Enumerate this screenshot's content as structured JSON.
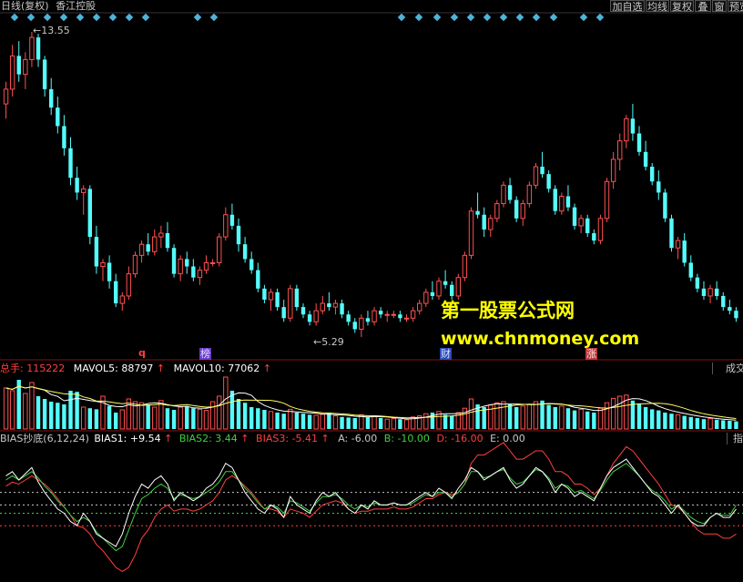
{
  "window": {
    "title_period": "日线(复权)",
    "stock_name": "香江控股",
    "right_buttons": [
      "加自选",
      "均线",
      "复权",
      "叠",
      "窗",
      "预览"
    ]
  },
  "price_chart": {
    "high_label": "13.55",
    "low_label": "5.29",
    "event_tags": [
      "q",
      "榜",
      "财",
      "涨"
    ]
  },
  "volume_panel": {
    "total_label": "总手",
    "total_value": "115222",
    "mavol5_label": "MAVOL5",
    "mavol5_value": "88797",
    "mavol10_label": "MAVOL10",
    "mavol10_value": "77062",
    "right_tab": "成交"
  },
  "bias_panel": {
    "name": "BIAS抄底(6,12,24)",
    "bias1": "BIAS1: +9.54",
    "bias2": "BIAS2: 3.44",
    "bias3": "BIAS3: -5.41",
    "a": "A: -6.00",
    "b": "B: -10.00",
    "d": "D: -16.00",
    "e": "E: 0.00",
    "right_tab": "指"
  },
  "watermark": {
    "line1": "第一股票公式网",
    "line2": "www.chnmoney.com"
  },
  "colors": {
    "up": "#ff5050",
    "down": "#54fcfc",
    "bias1": "#ffffff",
    "bias2": "#40d040",
    "bias3": "#ff4040",
    "watermark": "#ffff00"
  },
  "chart_data": {
    "type": "candlestick",
    "price_max": 13.55,
    "price_min": 5.29,
    "ohlc": [
      [
        11.6,
        12.2,
        11.2,
        12.0
      ],
      [
        12.0,
        13.2,
        11.8,
        12.9
      ],
      [
        12.9,
        13.3,
        12.2,
        12.4
      ],
      [
        12.4,
        13.0,
        12.0,
        12.8
      ],
      [
        12.8,
        13.55,
        12.6,
        13.4
      ],
      [
        13.4,
        13.5,
        12.6,
        12.8
      ],
      [
        12.8,
        12.9,
        11.8,
        12.0
      ],
      [
        12.0,
        12.3,
        11.3,
        11.5
      ],
      [
        11.5,
        11.8,
        10.8,
        11.0
      ],
      [
        11.0,
        11.3,
        10.2,
        10.4
      ],
      [
        10.4,
        10.7,
        9.4,
        9.6
      ],
      [
        9.6,
        9.9,
        9.0,
        9.2
      ],
      [
        9.2,
        9.4,
        8.6,
        9.3
      ],
      [
        9.3,
        9.4,
        7.8,
        8.0
      ],
      [
        8.0,
        8.3,
        7.0,
        7.2
      ],
      [
        7.2,
        7.4,
        6.8,
        7.3
      ],
      [
        7.3,
        7.5,
        6.6,
        6.8
      ],
      [
        6.8,
        7.0,
        6.1,
        6.2
      ],
      [
        6.2,
        6.5,
        6.0,
        6.4
      ],
      [
        6.4,
        7.2,
        6.3,
        7.0
      ],
      [
        7.0,
        7.6,
        6.9,
        7.5
      ],
      [
        7.5,
        7.9,
        7.3,
        7.8
      ],
      [
        7.8,
        8.1,
        7.5,
        7.6
      ],
      [
        7.6,
        8.2,
        7.5,
        8.0
      ],
      [
        8.0,
        8.3,
        7.7,
        8.1
      ],
      [
        8.1,
        8.4,
        7.6,
        7.7
      ],
      [
        7.7,
        7.8,
        6.9,
        7.0
      ],
      [
        7.0,
        7.5,
        6.8,
        7.4
      ],
      [
        7.4,
        7.6,
        7.0,
        7.2
      ],
      [
        7.2,
        7.4,
        6.8,
        6.9
      ],
      [
        6.9,
        7.2,
        6.7,
        7.1
      ],
      [
        7.1,
        7.5,
        7.0,
        7.3
      ],
      [
        7.3,
        7.4,
        7.2,
        7.3
      ],
      [
        7.3,
        8.1,
        7.2,
        8.0
      ],
      [
        8.0,
        8.8,
        7.9,
        8.6
      ],
      [
        8.6,
        8.9,
        8.2,
        8.3
      ],
      [
        8.3,
        8.5,
        7.6,
        7.8
      ],
      [
        7.8,
        8.0,
        7.3,
        7.4
      ],
      [
        7.4,
        7.6,
        7.0,
        7.1
      ],
      [
        7.1,
        7.3,
        6.5,
        6.6
      ],
      [
        6.6,
        6.7,
        6.2,
        6.3
      ],
      [
        6.3,
        6.6,
        6.0,
        6.5
      ],
      [
        6.5,
        6.6,
        6.0,
        6.1
      ],
      [
        6.1,
        6.3,
        5.7,
        5.8
      ],
      [
        5.8,
        6.7,
        5.7,
        6.6
      ],
      [
        6.6,
        6.7,
        6.0,
        6.1
      ],
      [
        6.1,
        6.2,
        5.8,
        5.9
      ],
      [
        5.9,
        6.0,
        5.6,
        5.7
      ],
      [
        5.7,
        6.2,
        5.6,
        6.0
      ],
      [
        6.0,
        6.4,
        5.9,
        6.2
      ],
      [
        6.2,
        6.5,
        6.0,
        6.1
      ],
      [
        6.1,
        6.3,
        5.9,
        6.2
      ],
      [
        6.2,
        6.3,
        5.8,
        5.9
      ],
      [
        5.9,
        6.0,
        5.6,
        5.7
      ],
      [
        5.7,
        5.8,
        5.4,
        5.5
      ],
      [
        5.5,
        5.9,
        5.29,
        5.8
      ],
      [
        5.8,
        6.0,
        5.6,
        5.7
      ],
      [
        5.7,
        6.1,
        5.6,
        6.0
      ],
      [
        6.0,
        6.1,
        5.8,
        5.9
      ],
      [
        5.9,
        6.0,
        5.7,
        5.9
      ],
      [
        5.9,
        6.0,
        5.8,
        5.9
      ],
      [
        5.9,
        6.0,
        5.7,
        5.8
      ],
      [
        5.8,
        5.9,
        5.7,
        5.8
      ],
      [
        5.8,
        6.1,
        5.7,
        6.0
      ],
      [
        6.0,
        6.3,
        5.9,
        6.2
      ],
      [
        6.2,
        6.6,
        6.1,
        6.5
      ],
      [
        6.5,
        6.8,
        6.3,
        6.4
      ],
      [
        6.4,
        6.9,
        6.3,
        6.8
      ],
      [
        6.8,
        7.1,
        6.6,
        6.7
      ],
      [
        6.7,
        6.8,
        6.3,
        6.4
      ],
      [
        6.4,
        7.0,
        6.3,
        6.9
      ],
      [
        6.9,
        7.6,
        6.8,
        7.5
      ],
      [
        7.5,
        8.8,
        7.4,
        8.7
      ],
      [
        8.7,
        9.2,
        8.5,
        8.6
      ],
      [
        8.6,
        8.8,
        8.0,
        8.2
      ],
      [
        8.2,
        8.6,
        8.0,
        8.5
      ],
      [
        8.5,
        9.0,
        8.4,
        8.9
      ],
      [
        8.9,
        9.5,
        8.8,
        9.4
      ],
      [
        9.4,
        9.6,
        8.9,
        9.0
      ],
      [
        9.0,
        9.1,
        8.4,
        8.5
      ],
      [
        8.5,
        9.0,
        8.3,
        8.9
      ],
      [
        8.9,
        9.5,
        8.8,
        9.4
      ],
      [
        9.4,
        10.0,
        9.3,
        9.9
      ],
      [
        9.9,
        10.3,
        9.6,
        9.7
      ],
      [
        9.7,
        9.8,
        9.2,
        9.3
      ],
      [
        9.3,
        9.4,
        8.6,
        8.7
      ],
      [
        8.7,
        9.2,
        8.6,
        9.1
      ],
      [
        9.1,
        9.4,
        8.7,
        8.8
      ],
      [
        8.8,
        8.9,
        8.2,
        8.3
      ],
      [
        8.3,
        8.6,
        8.1,
        8.5
      ],
      [
        8.5,
        8.6,
        8.0,
        8.1
      ],
      [
        8.1,
        8.2,
        7.8,
        7.9
      ],
      [
        7.9,
        8.6,
        7.8,
        8.5
      ],
      [
        8.5,
        9.6,
        8.4,
        9.5
      ],
      [
        9.5,
        10.3,
        9.3,
        10.1
      ],
      [
        10.1,
        10.8,
        9.8,
        10.6
      ],
      [
        10.6,
        11.3,
        10.4,
        11.2
      ],
      [
        11.2,
        11.6,
        10.6,
        10.8
      ],
      [
        10.8,
        11.0,
        10.2,
        10.3
      ],
      [
        10.3,
        10.6,
        9.8,
        9.9
      ],
      [
        9.9,
        10.0,
        9.4,
        9.5
      ],
      [
        9.5,
        9.8,
        9.0,
        9.2
      ],
      [
        9.2,
        9.3,
        8.4,
        8.5
      ],
      [
        8.5,
        8.6,
        7.6,
        7.7
      ],
      [
        7.7,
        8.0,
        7.4,
        7.9
      ],
      [
        7.9,
        8.1,
        7.2,
        7.3
      ],
      [
        7.3,
        7.5,
        6.8,
        6.9
      ],
      [
        6.9,
        7.0,
        6.5,
        6.6
      ],
      [
        6.6,
        6.8,
        6.3,
        6.4
      ],
      [
        6.4,
        6.7,
        6.2,
        6.6
      ],
      [
        6.6,
        6.8,
        6.3,
        6.4
      ],
      [
        6.4,
        6.5,
        6.0,
        6.1
      ],
      [
        6.1,
        6.3,
        5.9,
        6.0
      ],
      [
        6.0,
        6.1,
        5.7,
        5.8
      ]
    ],
    "volume": [
      75,
      70,
      90,
      65,
      85,
      60,
      55,
      50,
      48,
      45,
      70,
      68,
      40,
      38,
      36,
      60,
      42,
      30,
      35,
      55,
      50,
      48,
      45,
      40,
      52,
      38,
      35,
      40,
      42,
      38,
      36,
      34,
      50,
      60,
      95,
      70,
      55,
      48,
      40,
      38,
      35,
      32,
      30,
      28,
      36,
      30,
      28,
      26,
      25,
      27,
      30,
      24,
      22,
      21,
      20,
      26,
      22,
      24,
      20,
      18,
      19,
      18,
      17,
      22,
      24,
      28,
      30,
      32,
      26,
      24,
      30,
      38,
      55,
      45,
      40,
      44,
      48,
      50,
      46,
      40,
      42,
      45,
      50,
      52,
      44,
      40,
      42,
      38,
      34,
      36,
      32,
      30,
      38,
      48,
      56,
      60,
      62,
      52,
      46,
      40,
      36,
      34,
      30,
      28,
      26,
      24,
      22,
      20,
      18,
      19,
      17,
      16,
      15,
      14
    ],
    "bias1": [
      8,
      10,
      6,
      9,
      12,
      5,
      0,
      -4,
      -8,
      -10,
      -14,
      -16,
      -10,
      -14,
      -20,
      -22,
      -24,
      -26,
      -20,
      -10,
      -2,
      4,
      2,
      6,
      8,
      4,
      -4,
      0,
      -2,
      -4,
      -2,
      2,
      4,
      8,
      14,
      12,
      6,
      0,
      -4,
      -8,
      -10,
      -6,
      -8,
      -12,
      -2,
      -6,
      -8,
      -10,
      -4,
      0,
      -2,
      0,
      -4,
      -8,
      -10,
      -6,
      -8,
      -4,
      -6,
      -6,
      -5,
      -6,
      -6,
      -4,
      -2,
      0,
      -2,
      2,
      0,
      -3,
      2,
      6,
      12,
      10,
      6,
      8,
      10,
      12,
      6,
      2,
      4,
      8,
      12,
      10,
      6,
      0,
      4,
      2,
      -2,
      0,
      -2,
      -4,
      2,
      8,
      12,
      14,
      16,
      12,
      8,
      4,
      0,
      -2,
      -6,
      -10,
      -6,
      -10,
      -14,
      -16,
      -16,
      -12,
      -10,
      -12,
      -12,
      -8
    ],
    "bias2": [
      6,
      8,
      6,
      8,
      10,
      7,
      3,
      0,
      -4,
      -7,
      -11,
      -14,
      -12,
      -14,
      -19,
      -22,
      -25,
      -28,
      -26,
      -18,
      -10,
      -3,
      -1,
      2,
      4,
      2,
      -3,
      -1,
      -2,
      -3,
      -2,
      0,
      2,
      5,
      10,
      10,
      6,
      2,
      -1,
      -5,
      -8,
      -6,
      -7,
      -10,
      -4,
      -5,
      -7,
      -9,
      -5,
      -2,
      -2,
      -1,
      -3,
      -6,
      -8,
      -6,
      -7,
      -5,
      -6,
      -6,
      -5,
      -6,
      -6,
      -5,
      -3,
      -1,
      -2,
      0,
      0,
      -2,
      0,
      4,
      10,
      10,
      7,
      8,
      10,
      11,
      7,
      4,
      5,
      8,
      11,
      10,
      7,
      2,
      4,
      3,
      0,
      1,
      -1,
      -3,
      1,
      6,
      10,
      12,
      14,
      11,
      8,
      4,
      1,
      -1,
      -4,
      -8,
      -6,
      -9,
      -12,
      -14,
      -15,
      -12,
      -10,
      -11,
      -11,
      -6
    ],
    "bias3": [
      3,
      5,
      4,
      6,
      8,
      6,
      4,
      1,
      -3,
      -7,
      -11,
      -16,
      -17,
      -20,
      -25,
      -28,
      -32,
      -36,
      -38,
      -36,
      -30,
      -22,
      -18,
      -12,
      -8,
      -6,
      -9,
      -8,
      -8,
      -9,
      -8,
      -6,
      -4,
      0,
      6,
      8,
      6,
      3,
      0,
      -4,
      -8,
      -8,
      -9,
      -12,
      -8,
      -9,
      -10,
      -12,
      -9,
      -6,
      -5,
      -4,
      -5,
      -8,
      -10,
      -9,
      -9,
      -8,
      -8,
      -8,
      -7,
      -8,
      -8,
      -7,
      -5,
      -3,
      -3,
      -1,
      0,
      -1,
      0,
      4,
      14,
      18,
      18,
      20,
      22,
      24,
      20,
      16,
      16,
      18,
      20,
      20,
      16,
      10,
      10,
      8,
      4,
      4,
      2,
      -1,
      2,
      8,
      14,
      18,
      22,
      20,
      16,
      12,
      8,
      4,
      -1,
      -6,
      -7,
      -10,
      -14,
      -18,
      -20,
      -20,
      -20,
      -22,
      -22,
      -20
    ]
  }
}
